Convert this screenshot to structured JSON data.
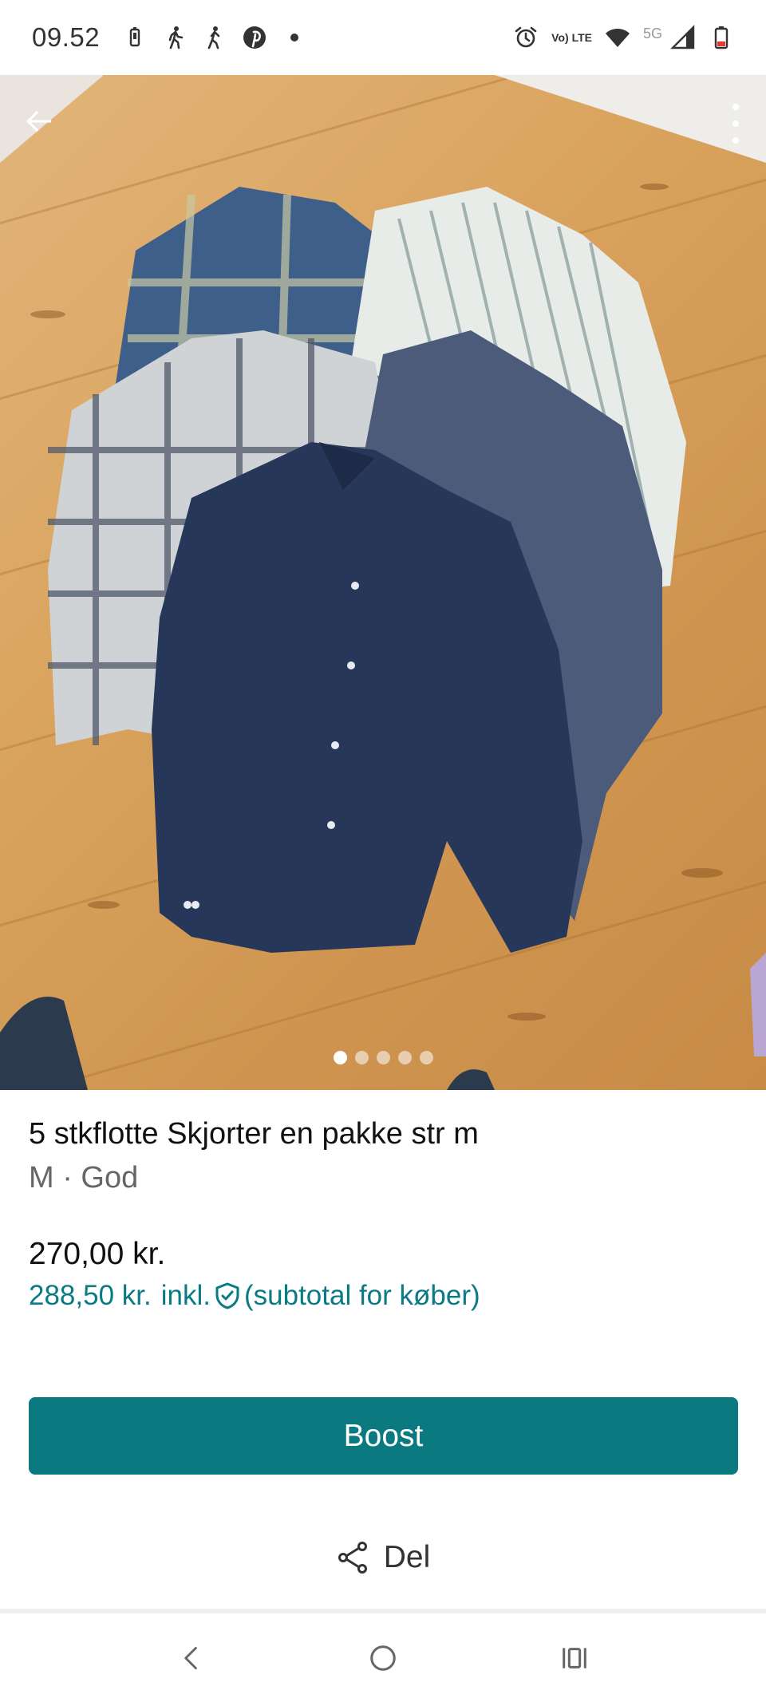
{
  "status_bar": {
    "time": "09.52",
    "left_icons": [
      "battery-saver-icon",
      "walking-icon",
      "walking-icon",
      "pinterest-icon",
      "dot-icon"
    ],
    "network_label": "Vo) LTE",
    "network_type": "5G",
    "right_icons": [
      "alarm-icon",
      "volte-icon",
      "wifi-icon",
      "signal-icon",
      "battery-icon"
    ]
  },
  "gallery": {
    "image_count": 5,
    "active_index": 0
  },
  "listing": {
    "title": "5 stkflotte  Skjorter en pakke str m",
    "meta": "M · God",
    "price": "270,00 kr.",
    "buyer_price": "288,50 kr.",
    "buyer_incl": "inkl.",
    "buyer_note": "(subtotal for køber)"
  },
  "actions": {
    "boost_label": "Boost",
    "share_label": "Del"
  },
  "colors": {
    "accent": "#0a7a80",
    "buyer_price_text": "#0a7a85"
  }
}
